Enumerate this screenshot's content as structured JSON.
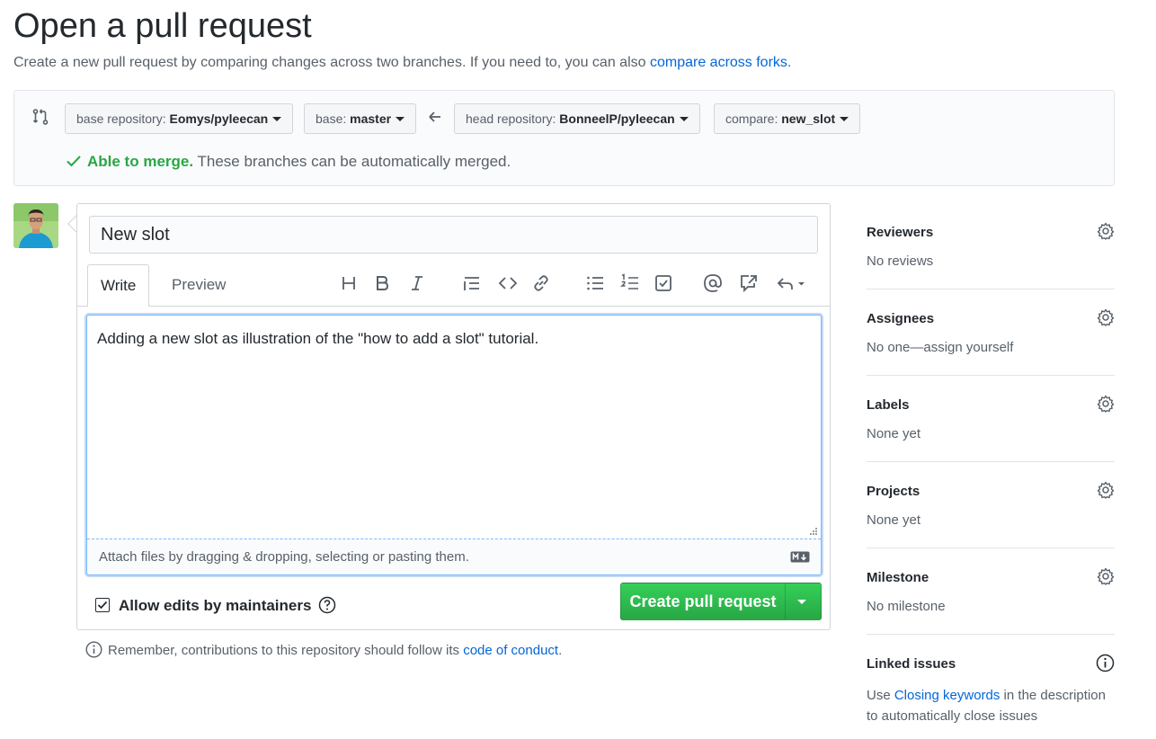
{
  "header": {
    "title": "Open a pull request",
    "subtitle_prefix": "Create a new pull request by comparing changes across two branches. If you need to, you can also ",
    "subtitle_link": "compare across forks",
    "subtitle_suffix": "."
  },
  "range": {
    "base_repo_label": "base repository: ",
    "base_repo_value": "Eomys/pyleecan",
    "base_label": "base: ",
    "base_value": "master",
    "head_repo_label": "head repository: ",
    "head_repo_value": "BonneelP/pyleecan",
    "compare_label": "compare: ",
    "compare_value": "new_slot",
    "merge_ok": "Able to merge.",
    "merge_msg": " These branches can be automatically merged."
  },
  "editor": {
    "title_value": "New slot",
    "tab_write": "Write",
    "tab_preview": "Preview",
    "body_value": "Adding a new slot as illustration of the \"how to add a slot\" tutorial.",
    "attach_hint": "Attach files by dragging & dropping, selecting or pasting them.",
    "allow_edits": "Allow edits by maintainers",
    "create_button": "Create pull request"
  },
  "reminder": {
    "prefix": "Remember, contributions to this repository should follow its ",
    "link": "code of conduct",
    "suffix": "."
  },
  "sidebar": {
    "reviewers": {
      "label": "Reviewers",
      "value": "No reviews"
    },
    "assignees": {
      "label": "Assignees",
      "value": "No one—assign yourself"
    },
    "labels": {
      "label": "Labels",
      "value": "None yet"
    },
    "projects": {
      "label": "Projects",
      "value": "None yet"
    },
    "milestone": {
      "label": "Milestone",
      "value": "No milestone"
    },
    "linked": {
      "label": "Linked issues",
      "prefix": "Use ",
      "link": "Closing keywords",
      "suffix": " in the description to automatically close issues"
    }
  },
  "colors": {
    "accent_green": "#28a745",
    "link_blue": "#0366d6",
    "focus_blue": "#79b8ff"
  }
}
